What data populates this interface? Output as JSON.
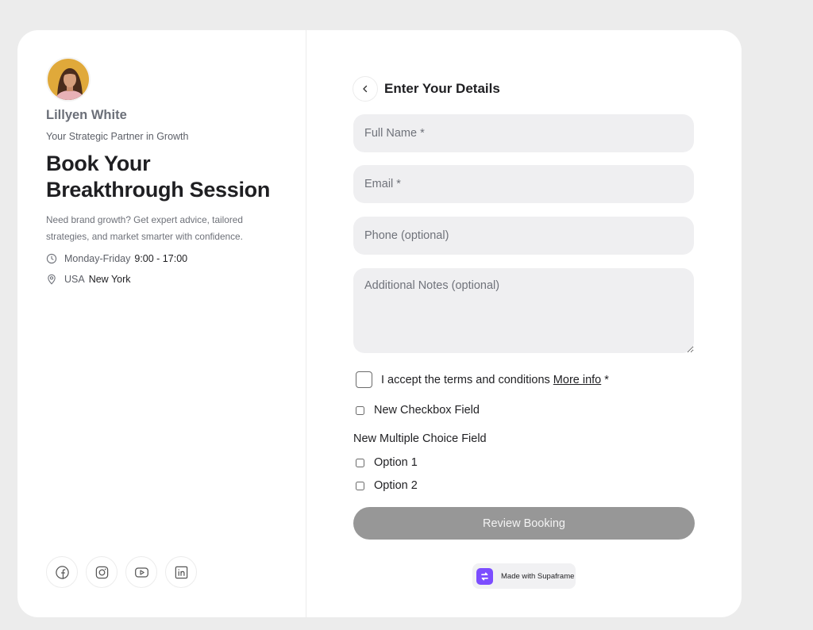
{
  "host": {
    "name": "Lillyen White",
    "tagline": "Your Strategic Partner in Growth",
    "headline": "Book Your Breakthrough Session",
    "description": "Need brand growth? Get expert advice, tailored strategies, and market smarter with confidence.",
    "schedule": {
      "days": "Monday-Friday",
      "hours": "9:00 - 17:00"
    },
    "location": {
      "country": "USA",
      "city": "New York"
    }
  },
  "socials": [
    {
      "icon": "facebook-icon"
    },
    {
      "icon": "instagram-icon"
    },
    {
      "icon": "youtube-icon"
    },
    {
      "icon": "linkedin-icon"
    }
  ],
  "form": {
    "title": "Enter Your Details",
    "full_name": {
      "placeholder": "Full Name *",
      "value": ""
    },
    "email": {
      "placeholder": "Email *",
      "value": ""
    },
    "phone": {
      "placeholder": "Phone (optional)",
      "value": ""
    },
    "notes": {
      "placeholder": "Additional Notes (optional)",
      "value": ""
    },
    "terms": {
      "text": "I accept the terms and conditions",
      "link": "More info",
      "required_mark": "*",
      "checked": false
    },
    "new_checkbox": {
      "label": "New Checkbox Field",
      "checked": false
    },
    "multiple_choice": {
      "label": "New Multiple Choice Field",
      "options": [
        {
          "label": "Option 1",
          "checked": false
        },
        {
          "label": "Option 2",
          "checked": false
        }
      ]
    },
    "submit_label": "Review Booking"
  },
  "badge": {
    "text": "Made with Supaframe"
  },
  "colors": {
    "background": "#ececec",
    "card": "#ffffff",
    "input_bg": "#efeff1",
    "button_disabled": "#979797",
    "brand_purple": "#7c4dff"
  }
}
